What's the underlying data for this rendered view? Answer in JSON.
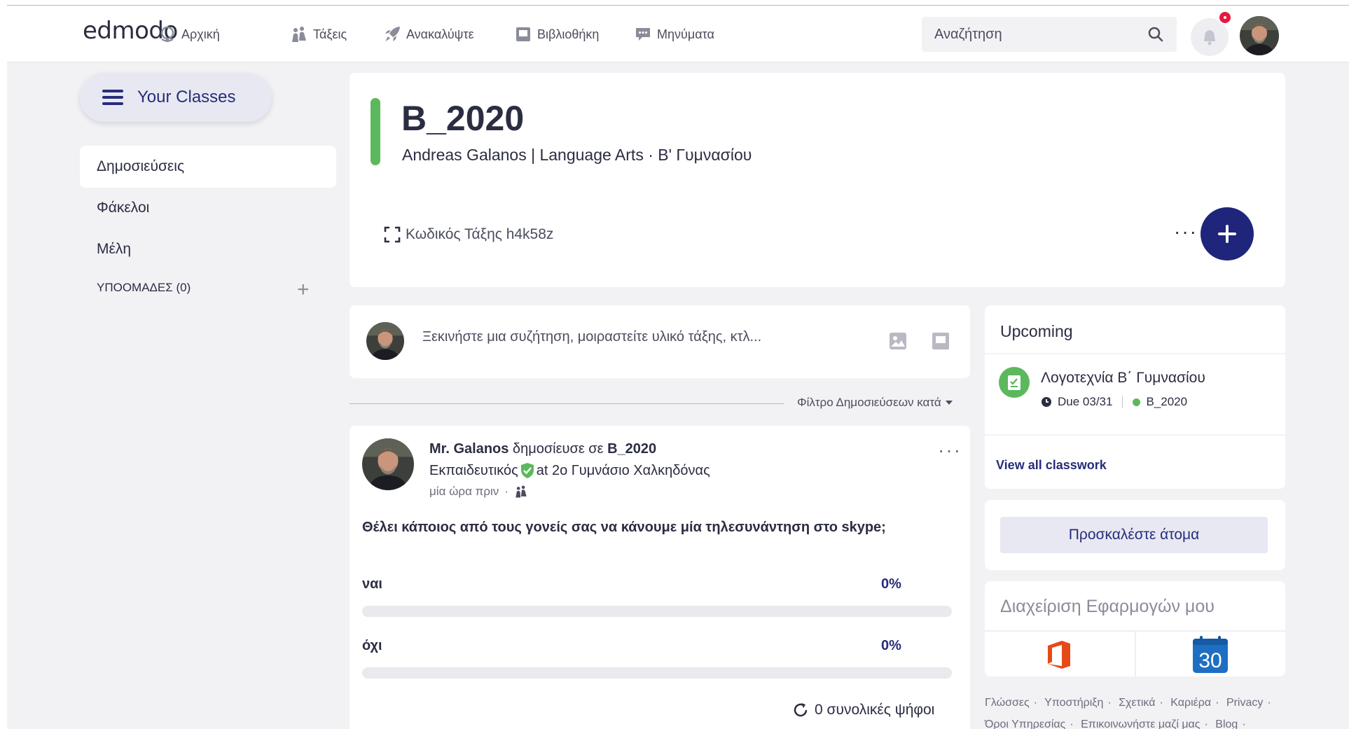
{
  "brand": {
    "logo": "edmodo",
    "accent": "#272d7a",
    "class_color": "#5cb85c",
    "alert_color": "#e8173c"
  },
  "nav": {
    "items": [
      {
        "label": "Αρχική",
        "icon": "home-globe-icon"
      },
      {
        "label": "Τάξεις",
        "icon": "classes-icon"
      },
      {
        "label": "Ανακαλύψτε",
        "icon": "rocket-icon"
      },
      {
        "label": "Βιβλιοθήκη",
        "icon": "library-icon"
      },
      {
        "label": "Μηνύματα",
        "icon": "chat-icon"
      }
    ],
    "search_placeholder": "Αναζήτηση"
  },
  "sidebar": {
    "your_classes": "Your Classes",
    "items": [
      {
        "label": "Δημοσιεύσεις"
      },
      {
        "label": "Φάκελοι"
      },
      {
        "label": "Μέλη"
      }
    ],
    "subgroups": "ΥΠΟΟΜΑΔΕΣ (0)"
  },
  "class": {
    "title": "B_2020",
    "subtitle": "Andreas Galanos | Language Arts  · Β' Γυμνασίου",
    "code": "Κωδικός Τάξης h4k58z"
  },
  "composer": {
    "placeholder": "Ξεκινήστε μια συζήτηση, μοιραστείτε υλικό τάξης, κτλ..."
  },
  "filter": {
    "label": "Φίλτρο Δημοσιεύσεων κατά"
  },
  "post": {
    "author": "Mr. Galanos",
    "action": " δημοσίευσε σε ",
    "target": "B_2020",
    "role_before": "Εκπαιδευτικός",
    "role_after": "at 2ο Γυμνάσιο Χαλκηδόνας",
    "time": "μία ώρα πριν",
    "question": "Θέλει κάποιος από τους γονείς σας να κάνουμε μία τηλεσυνάντηση στο skype;",
    "options": [
      {
        "label": "ναι",
        "percent_text": "0%",
        "percent": 0
      },
      {
        "label": "όχι",
        "percent_text": "0%",
        "percent": 0
      }
    ],
    "total_votes": "0 συνολικές ψήφοι"
  },
  "upcoming": {
    "title": "Upcoming",
    "task_title": "Λογοτεχνία Β΄ Γυμνασίου",
    "due": "Due 03/31",
    "class": "B_2020",
    "view_all": "View all classwork"
  },
  "invite": {
    "label": "Προσκαλέστε άτομα"
  },
  "apps": {
    "title": "Διαχείριση Εφαρμογών μου",
    "calendar_day": "30",
    "office_color": "#e64a19",
    "calendar_color": "#1e6fc2"
  },
  "footer": {
    "links": [
      "Γλώσσες",
      "Υποστήριξη",
      "Σχετικά",
      "Καριέρα",
      "Privacy",
      "Όροι Υπηρεσίας",
      "Επικοινωνήστε μαζί μας",
      "Blog"
    ]
  }
}
